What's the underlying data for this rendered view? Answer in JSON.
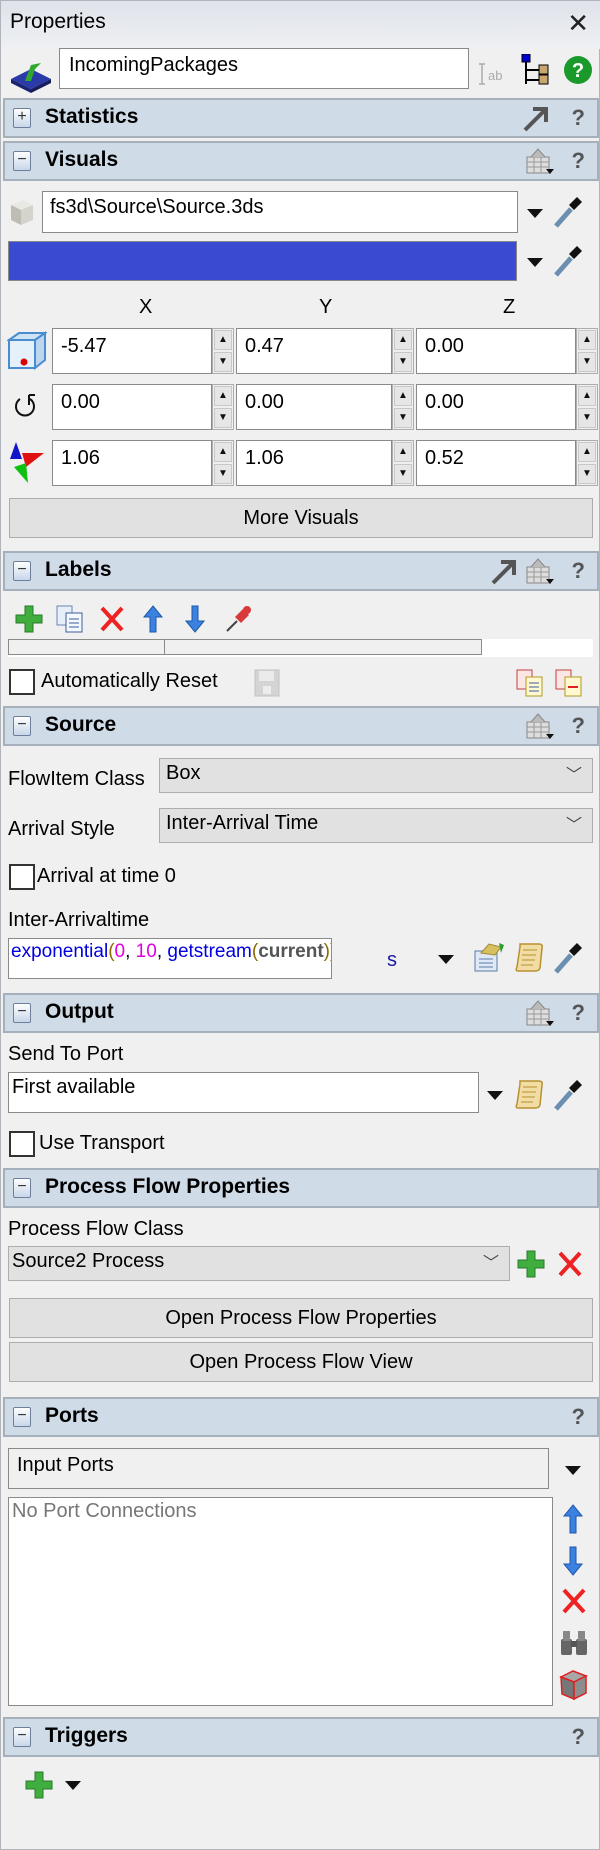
{
  "window": {
    "title": "Properties",
    "close_label": "✕"
  },
  "object": {
    "name": "IncomingPackages"
  },
  "sections": {
    "statistics": {
      "title": "Statistics",
      "toggle": "+"
    },
    "visuals": {
      "title": "Visuals",
      "toggle": "−"
    },
    "labels": {
      "title": "Labels",
      "toggle": "−"
    },
    "source": {
      "title": "Source",
      "toggle": "−"
    },
    "output": {
      "title": "Output",
      "toggle": "−"
    },
    "process_flow": {
      "title": "Process Flow Properties",
      "toggle": "−"
    },
    "ports": {
      "title": "Ports",
      "toggle": "−"
    },
    "triggers": {
      "title": "Triggers",
      "toggle": "−"
    }
  },
  "help_label": "?",
  "visuals": {
    "model_path": "fs3d\\Source\\Source.3ds",
    "color": "#3a4bd1",
    "axes": [
      "X",
      "Y",
      "Z"
    ],
    "position": [
      "-5.47",
      "0.47",
      "0.00"
    ],
    "rotation": [
      "0.00",
      "0.00",
      "0.00"
    ],
    "size": [
      "1.06",
      "1.06",
      "0.52"
    ],
    "more_visuals_label": "More Visuals"
  },
  "labels": {
    "automatically_reset_label": "Automatically Reset",
    "automatically_reset_checked": false
  },
  "source": {
    "flowitem_class_label": "FlowItem Class",
    "flowitem_class_value": "Box",
    "arrival_style_label": "Arrival Style",
    "arrival_style_value": "Inter-Arrival Time",
    "arrival_at_time0_label": "Arrival at time 0",
    "arrival_at_time0_checked": false,
    "interarrival_label": "Inter-Arrivaltime",
    "interarrival_code": {
      "fn1": "exponential",
      "p1": "(",
      "n1": "0",
      "c1": ", ",
      "n2": "10",
      "c2": ", ",
      "fn2": "getstream",
      "p2": "(",
      "kw": "current",
      "p3": "))"
    },
    "interarrival_unit": "s"
  },
  "output": {
    "send_to_port_label": "Send To Port",
    "send_to_port_value": "First available",
    "use_transport_label": "Use Transport",
    "use_transport_checked": false
  },
  "process_flow": {
    "class_label": "Process Flow Class",
    "class_value": "Source2 Process",
    "open_properties_label": "Open Process Flow Properties",
    "open_view_label": "Open Process Flow View"
  },
  "ports": {
    "port_type": "Input Ports",
    "empty_text": "No Port Connections"
  }
}
